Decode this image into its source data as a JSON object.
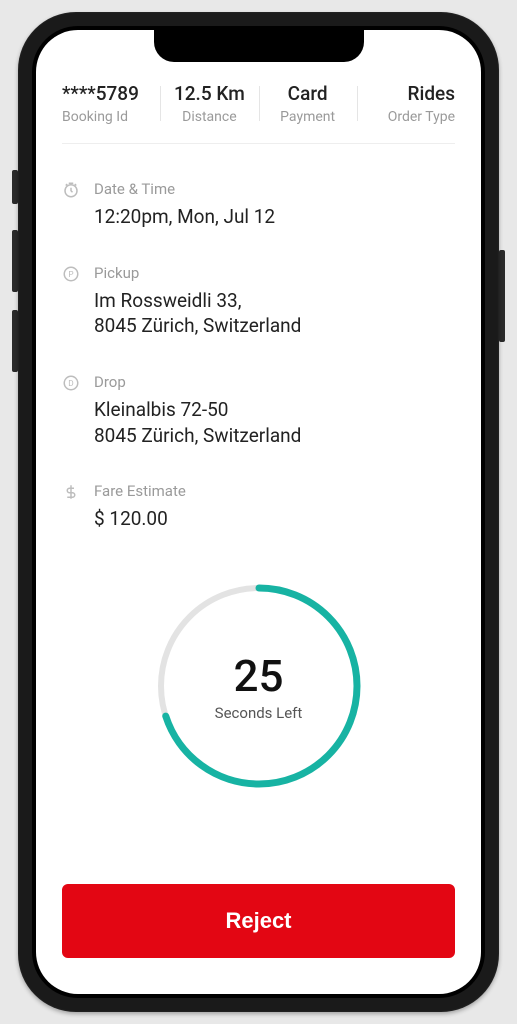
{
  "header": {
    "booking_id": {
      "value": "****5789",
      "label": "Booking Id"
    },
    "distance": {
      "value": "12.5 Km",
      "label": "Distance"
    },
    "payment": {
      "value": "Card",
      "label": "Payment"
    },
    "order_type": {
      "value": "Rides",
      "label": "Order Type"
    }
  },
  "details": {
    "datetime": {
      "label": "Date & Time",
      "value": "12:20pm, Mon, Jul 12"
    },
    "pickup": {
      "label": "Pickup",
      "value": "Im Rossweidli 33,\n8045 Zürich, Switzerland"
    },
    "drop": {
      "label": "Drop",
      "value": "Kleinalbis 72-50\n8045 Zürich, Switzerland"
    },
    "fare": {
      "label": "Fare Estimate",
      "value": "$ 120.00"
    }
  },
  "timer": {
    "seconds": "25",
    "label": "Seconds Left",
    "progress_pct": 70,
    "color": "#17b3a3",
    "track_color": "#e3e3e3"
  },
  "actions": {
    "reject_label": "Reject"
  }
}
